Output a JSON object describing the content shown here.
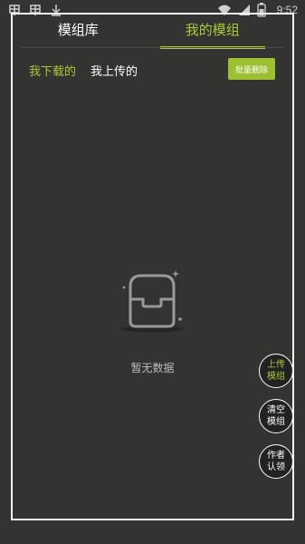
{
  "status_bar": {
    "left_icons": [
      "bug-icon",
      "bug-icon",
      "download-icon"
    ],
    "right_icons": [
      "wifi-icon",
      "signal-icon",
      "battery-icon"
    ],
    "time": "9:52"
  },
  "tabs": [
    {
      "label": "模组库",
      "active": false
    },
    {
      "label": "我的模组",
      "active": true
    }
  ],
  "subtabs": [
    {
      "label": "我下载的",
      "active": true
    },
    {
      "label": "我上传的",
      "active": false
    }
  ],
  "batch_delete_label": "批量删除",
  "empty_state": {
    "icon": "empty-box-icon",
    "text": "暂无数据"
  },
  "fabs": [
    {
      "label": "上传\n模组"
    },
    {
      "label": "清空\n模组"
    },
    {
      "label": "作者\n认领"
    }
  ],
  "colors": {
    "accent": "#a9c83a",
    "background": "#333331",
    "border": "#f3f3f3"
  }
}
